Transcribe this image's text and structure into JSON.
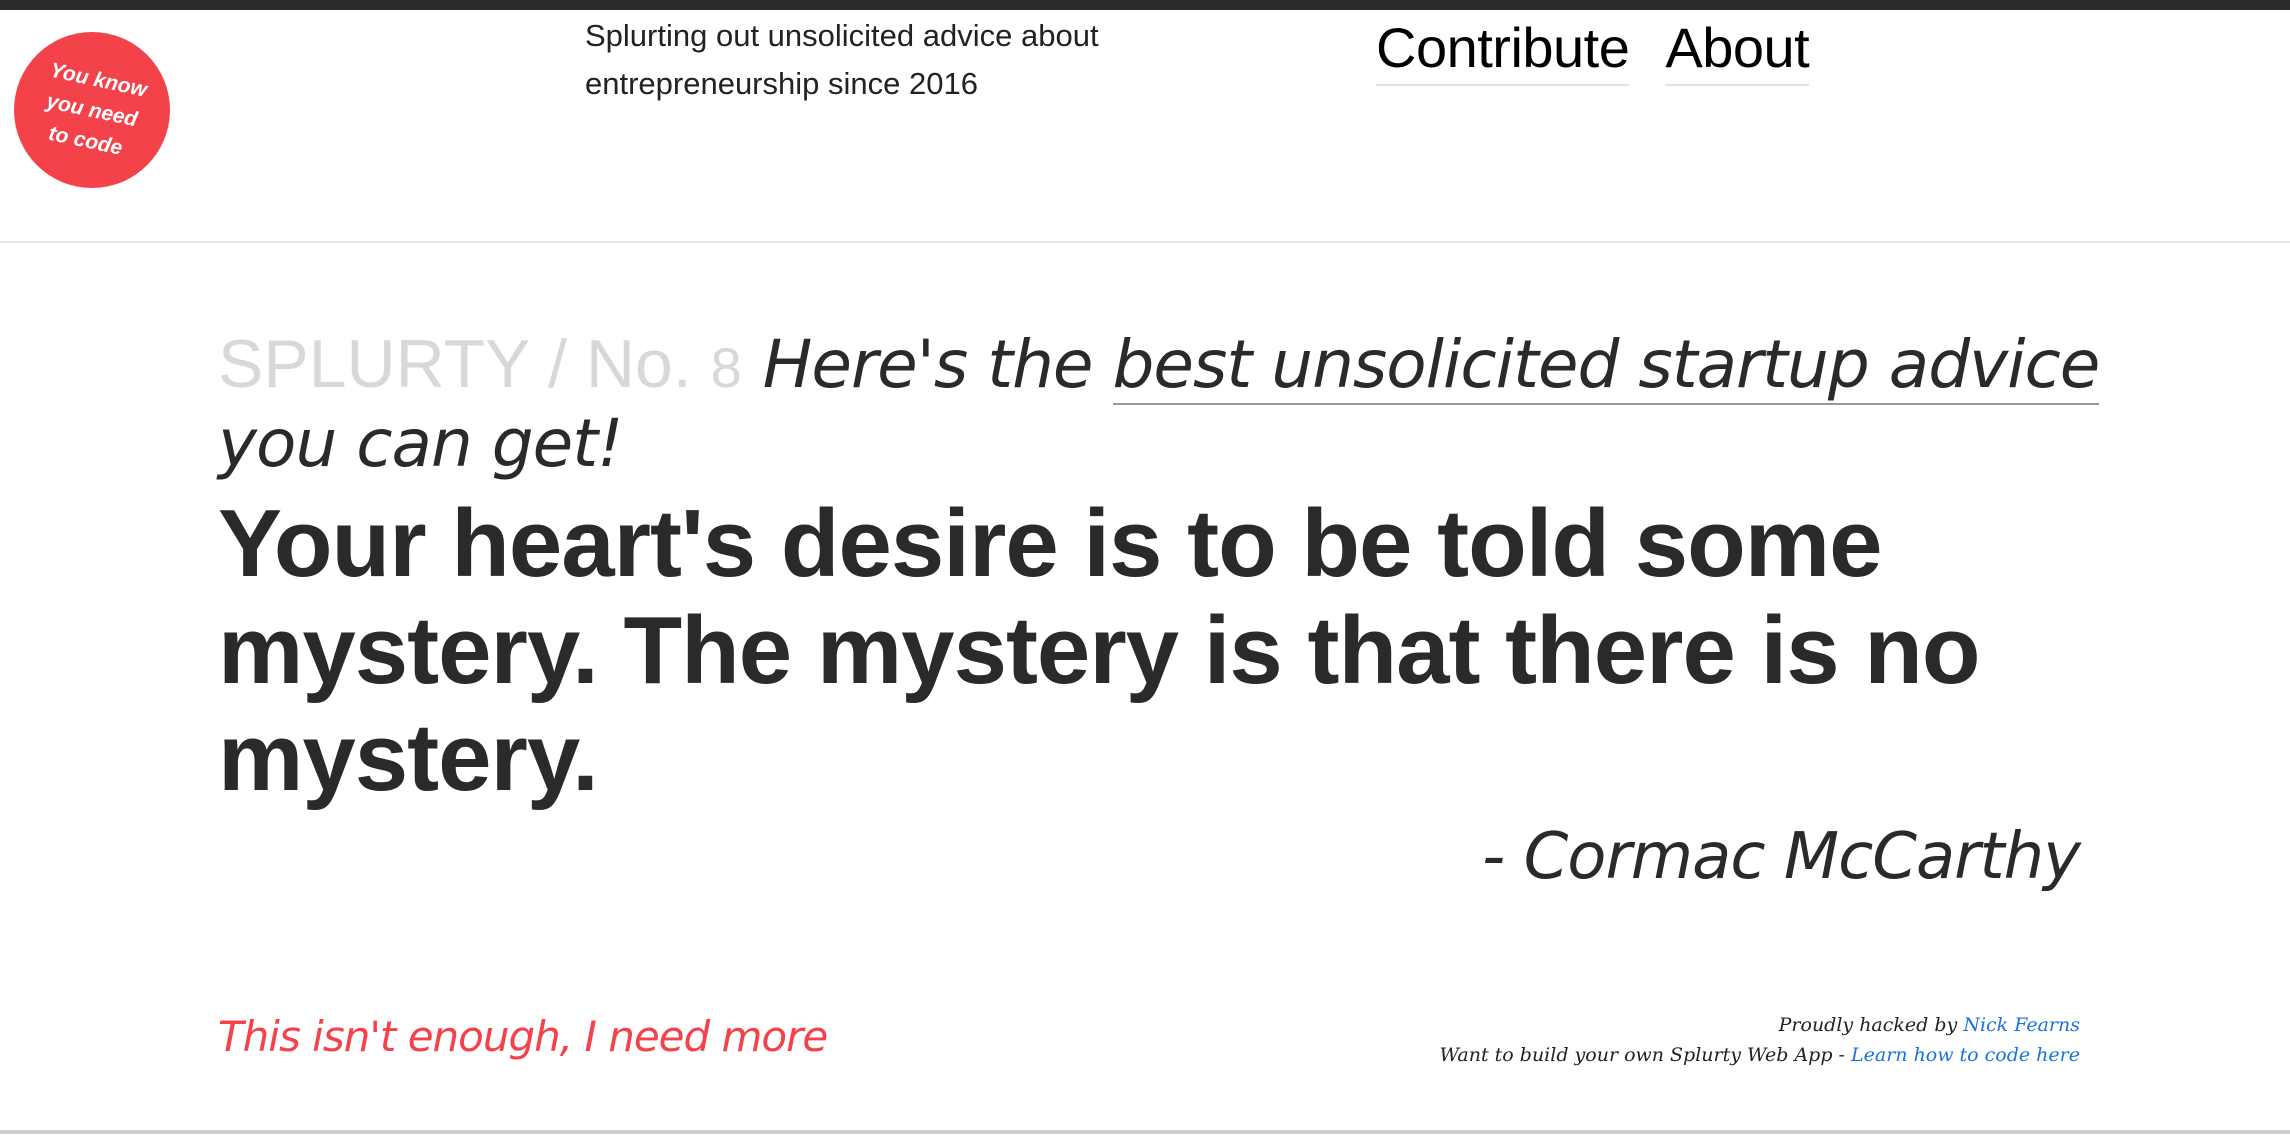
{
  "badge": {
    "lines": [
      "You know",
      "you need",
      "to code"
    ],
    "color": "#f4424b"
  },
  "header": {
    "tagline_lines": [
      "Splurting out unsolicited advice about",
      "entrepreneurship since 2016"
    ],
    "nav": {
      "contribute": "Contribute",
      "about": "About"
    }
  },
  "heading": {
    "brand": "SPLURTY / No.",
    "number": "8",
    "prefix": "Here's the",
    "link": "best unsolicited startup advice",
    "suffix": "you can get!"
  },
  "quote": {
    "text": "Your heart's desire is to be told some mystery. The mystery is that there is no mystery.",
    "author": "- Cormac McCarthy"
  },
  "more_link": "This isn't enough, I need more",
  "footer": {
    "line1_prefix": "Proudly hacked by",
    "line1_link": "Nick Fearns",
    "line2_prefix": "Want to build your own Splurty Web App -",
    "line2_link": "Learn how to code here",
    "link_color": "#1a73d9"
  }
}
